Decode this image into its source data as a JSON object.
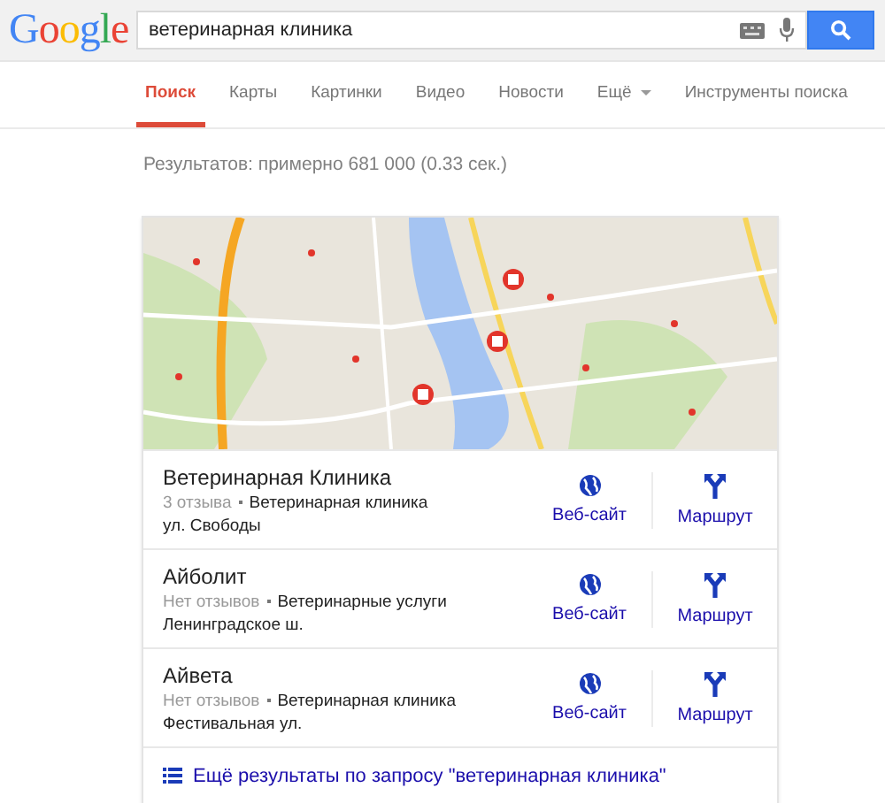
{
  "logo": "Google",
  "search": {
    "value": "ветеринарная клиника"
  },
  "tabs": [
    {
      "label": "Поиск",
      "selected": true
    },
    {
      "label": "Карты",
      "selected": false
    },
    {
      "label": "Картинки",
      "selected": false
    },
    {
      "label": "Видео",
      "selected": false
    },
    {
      "label": "Новости",
      "selected": false
    },
    {
      "label": "Ещё",
      "selected": false,
      "kind": "dropdown"
    },
    {
      "label": "Инструменты поиска",
      "selected": false
    }
  ],
  "result_stats": "Результатов: примерно 681 000 (0.33 сек.)",
  "local_results": {
    "places": [
      {
        "name": "Ветеринарная Клиника",
        "reviews": "3 отзыва",
        "category": "Ветеринарная клиника",
        "address": "ул. Свободы",
        "website": "Веб-сайт",
        "directions": "Маршрут"
      },
      {
        "name": "Айболит",
        "reviews": "Нет отзывов",
        "category": "Ветеринарные услуги",
        "address": "Ленинградское ш.",
        "website": "Веб-сайт",
        "directions": "Маршрут"
      },
      {
        "name": "Айвета",
        "reviews": "Нет отзывов",
        "category": "Ветеринарная клиника",
        "address": "Фестивальная ул.",
        "website": "Веб-сайт",
        "directions": "Маршрут"
      }
    ],
    "more_link": "Ещё результаты по запросу \"ветеринарная клиника\""
  }
}
